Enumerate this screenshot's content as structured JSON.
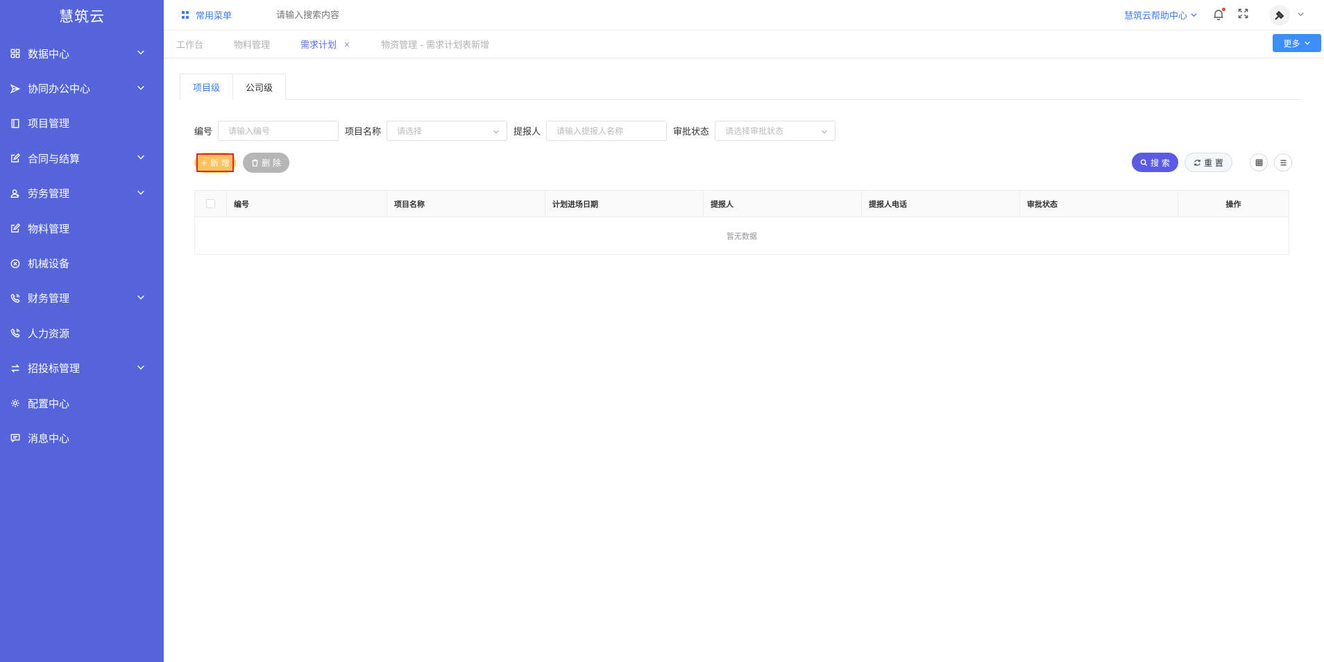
{
  "app": {
    "title": "慧筑云"
  },
  "sidebar": {
    "items": [
      {
        "label": "数据中心",
        "icon": "grid-icon",
        "expandable": true
      },
      {
        "label": "协同办公中心",
        "icon": "send-icon",
        "expandable": true
      },
      {
        "label": "项目管理",
        "icon": "book-icon",
        "expandable": false
      },
      {
        "label": "合同与结算",
        "icon": "edit-icon",
        "expandable": true
      },
      {
        "label": "劳务管理",
        "icon": "worker-icon",
        "expandable": true
      },
      {
        "label": "物料管理",
        "icon": "edit-icon",
        "expandable": false
      },
      {
        "label": "机械设备",
        "icon": "close-circle-icon",
        "expandable": false
      },
      {
        "label": "财务管理",
        "icon": "phone-icon",
        "expandable": true
      },
      {
        "label": "人力资源",
        "icon": "phone-icon",
        "expandable": false
      },
      {
        "label": "招投标管理",
        "icon": "swap-icon",
        "expandable": true
      },
      {
        "label": "配置中心",
        "icon": "gear-icon",
        "expandable": false
      },
      {
        "label": "消息中心",
        "icon": "message-icon",
        "expandable": false
      }
    ]
  },
  "topbar": {
    "favorites_label": "常用菜单",
    "search_placeholder": "请输入搜索内容",
    "help_label": "慧筑云帮助中心"
  },
  "tabs": {
    "items": [
      {
        "label": "工作台",
        "active": false
      },
      {
        "label": "物料管理",
        "active": false
      },
      {
        "label": "需求计划",
        "active": true,
        "closable": true,
        "close_symbol": "×"
      },
      {
        "label": "物资管理 - 需求计划表新增",
        "active": false
      }
    ],
    "more_label": "更多"
  },
  "level_tabs": [
    {
      "label": "项目级",
      "active": true
    },
    {
      "label": "公司级",
      "active": false
    }
  ],
  "filters": {
    "code": {
      "label": "编号",
      "placeholder": "请输入编号"
    },
    "project_name": {
      "label": "项目名称",
      "placeholder": "请选择"
    },
    "reporter": {
      "label": "提报人",
      "placeholder": "请输入提报人名称"
    },
    "approval_status": {
      "label": "审批状态",
      "placeholder": "请选择审批状态"
    }
  },
  "actions": {
    "add_label": "+ 新 增",
    "delete_label": "删 除",
    "search_label": "搜 索",
    "reset_label": "重 置"
  },
  "table": {
    "columns": [
      "编号",
      "项目名称",
      "计划进场日期",
      "提报人",
      "提报人电话",
      "审批状态",
      "操作"
    ],
    "empty_text": "暂无数据"
  },
  "colors": {
    "sidebar_bg": "#5565d9",
    "primary": "#3e7df0",
    "add_button": "#ffc25c",
    "search_button": "#5a5ae6"
  }
}
